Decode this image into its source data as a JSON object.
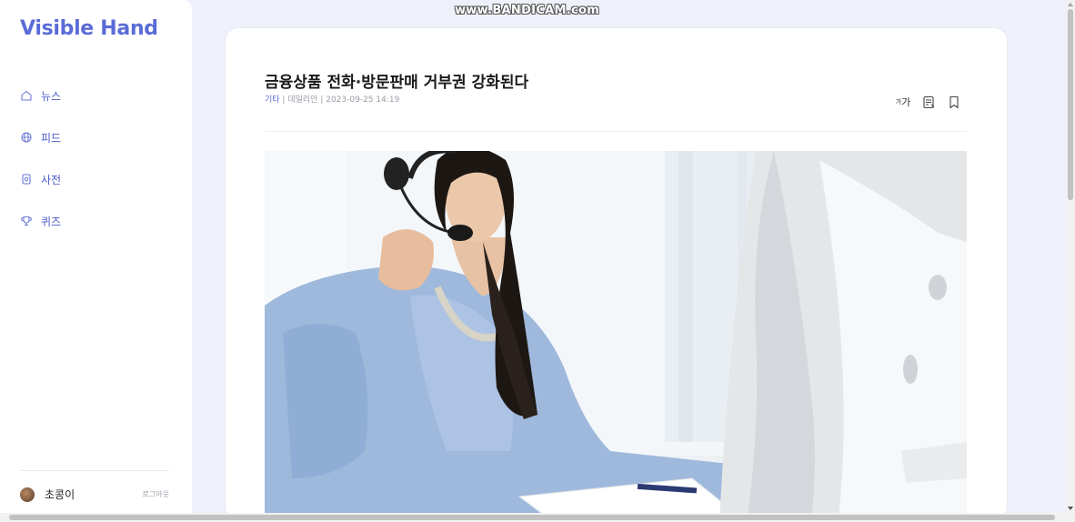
{
  "watermark": "www.BANDICAM.com",
  "sidebar": {
    "logo": "Visible Hand",
    "items": [
      {
        "label": "뉴스",
        "icon": "home-icon"
      },
      {
        "label": "피드",
        "icon": "globe-icon"
      },
      {
        "label": "사전",
        "icon": "dictionary-icon"
      },
      {
        "label": "퀴즈",
        "icon": "trophy-icon"
      }
    ],
    "user": {
      "name": "초콩이",
      "logout": "로그아웃"
    }
  },
  "article": {
    "title": "금융상품 전화·방문판매 거부권 강화된다",
    "category": "기타",
    "source": "데일리안",
    "datetime": "2023-09-25 14:19",
    "meta_sep": " | ",
    "tools": {
      "font_size_small": "가",
      "font_size_large": "가",
      "memo_icon": "memo-icon",
      "bookmark_icon": "bookmark-icon"
    },
    "image": {
      "subject": "woman-with-headset-at-computer"
    }
  },
  "colors": {
    "accent": "#5b6bd6",
    "background": "#eef1f9",
    "card": "#ffffff"
  }
}
